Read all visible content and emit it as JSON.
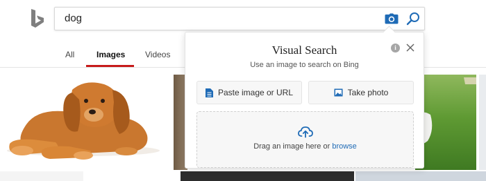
{
  "search": {
    "query": "dog"
  },
  "tabs": [
    {
      "label": "All"
    },
    {
      "label": "Images"
    },
    {
      "label": "Videos"
    }
  ],
  "visual_search": {
    "title": "Visual Search",
    "subtitle": "Use an image to search on Bing",
    "info_glyph": "i",
    "paste_label": "Paste image or URL",
    "photo_label": "Take photo",
    "drop_text": "Drag an image here or ",
    "browse_label": "browse"
  },
  "colors": {
    "accent_blue": "#1f6bb6",
    "active_tab_underline": "#c71a1a",
    "logo_gray": "#7f7f7f"
  },
  "icons": [
    "bing-logo",
    "camera-icon",
    "search-icon",
    "info-icon",
    "close-icon",
    "document-icon",
    "image-icon",
    "upload-cloud-icon"
  ]
}
